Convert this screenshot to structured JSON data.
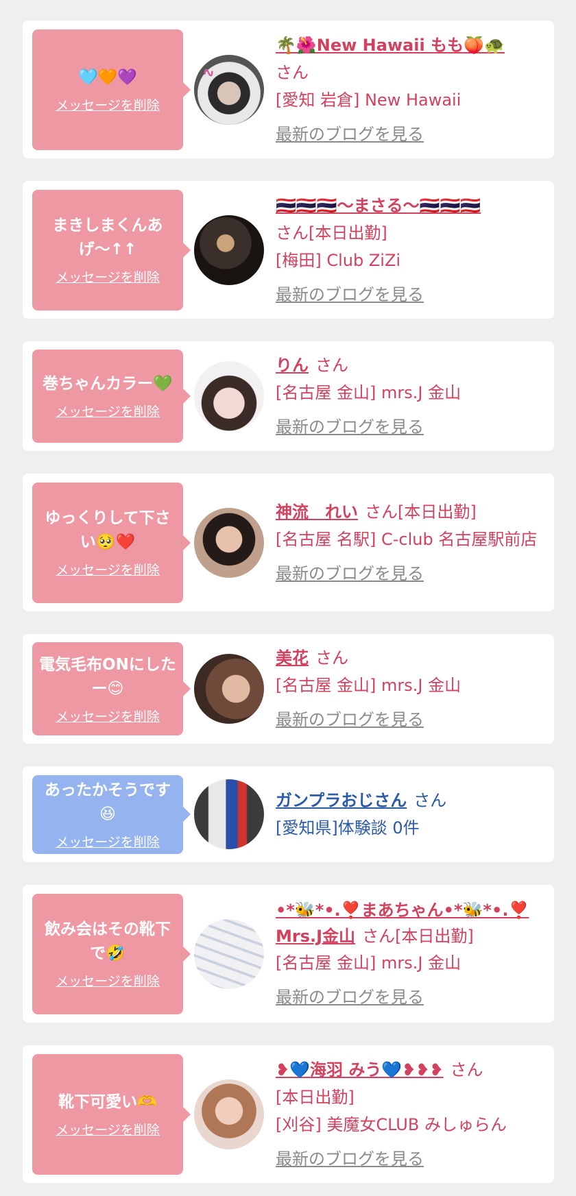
{
  "delete_label": "メッセージを削除",
  "blog_label": "最新のブログを見る",
  "colors": {
    "pink_bubble": "#ee98a3",
    "blue_bubble": "#95b3ee",
    "name_red": "#d2415e",
    "name_blue": "#2a5aa8"
  },
  "cards": [
    {
      "message": "🩵🧡💜",
      "name": "🌴🌺New Hawaii もも🍑🐢",
      "san": "さん",
      "status": "",
      "shop": "[愛知 岩倉] New Hawaii",
      "avatar": "logo-photo"
    },
    {
      "message": "まきしまくんあげ〜↑↑",
      "name": "🇹🇭🇹🇭🇹🇭〜まさる〜🇹🇭🇹🇭🇹🇭",
      "san": "さん",
      "status": "[本日出勤]",
      "shop": "[梅田] Club ZiZi",
      "avatar": "group-photo"
    },
    {
      "message": "巻ちゃんカラー💚",
      "name": "りん",
      "san": "さん",
      "status": "",
      "shop": "[名古屋 金山] mrs.J 金山",
      "avatar": "girl-photo"
    },
    {
      "message": "ゆっくりして下さい🥺❤️",
      "name": "神流　れい",
      "san": "さん",
      "status": "[本日出勤]",
      "shop": "[名古屋 名駅] C-club 名古屋駅前店",
      "avatar": "woman-photo"
    },
    {
      "message": "電気毛布ONにしたー😊",
      "name": "美花",
      "san": "さん",
      "status": "",
      "shop": "[名古屋 金山] mrs.J 金山",
      "avatar": "woman-photo-2"
    },
    {
      "message": "あったかそうです😆",
      "name": "ガンプラおじさん",
      "san": "さん",
      "status": "",
      "shop": "[愛知県]体験談 0件",
      "avatar": "robot-photo"
    },
    {
      "message": "飲み会はその靴下で🤣",
      "name": "•*🐝*•.❣️まあちゃん•*🐝*•.❣️Mrs.J金山",
      "san": "さん",
      "status": "[本日出勤]",
      "shop": "[名古屋 金山] mrs.J 金山",
      "avatar": "socks-photo"
    },
    {
      "message": "靴下可愛い🫶",
      "name": "❥💙海羽 みう💙❥❥❥",
      "san": "さん",
      "status": "[本日出勤]",
      "shop": "[刈谷] 美魔女CLUB みしゅらん",
      "avatar": "woman-photo-3"
    }
  ]
}
